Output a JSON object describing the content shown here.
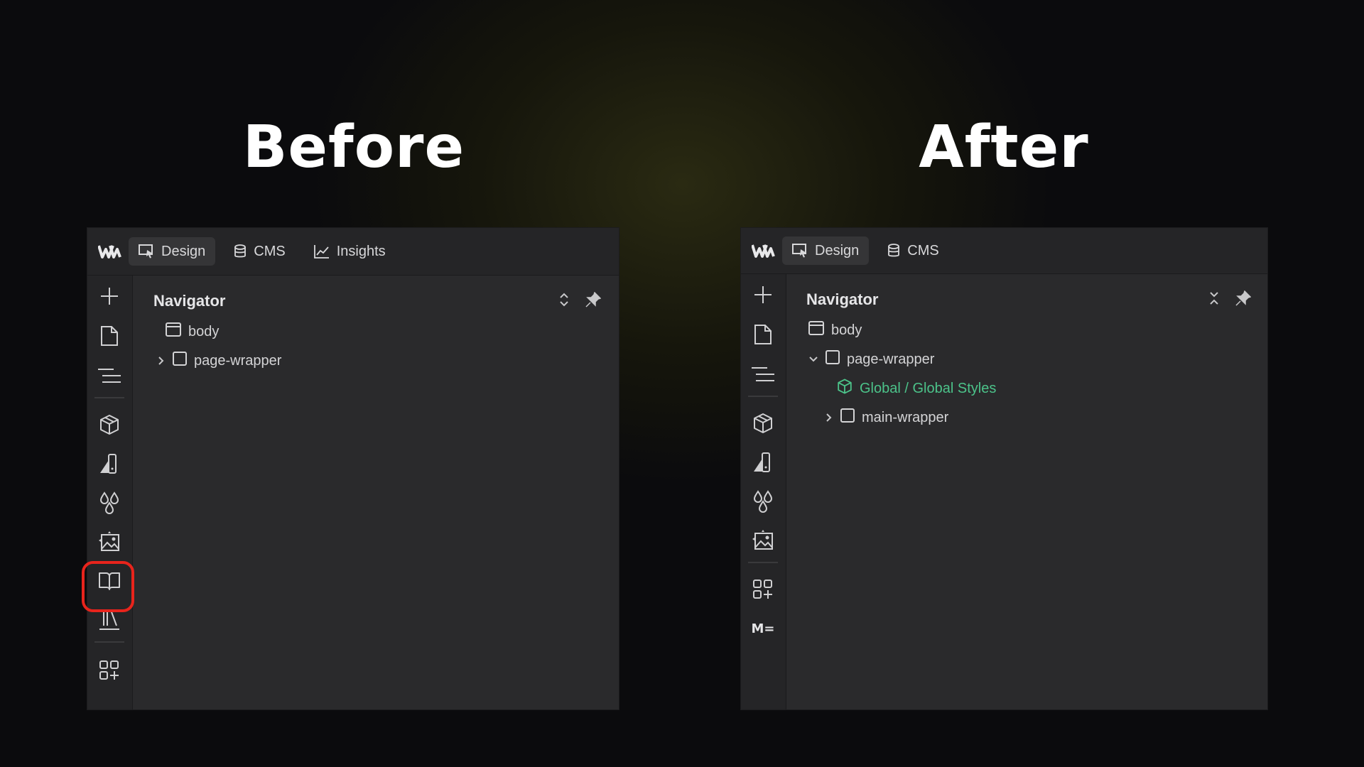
{
  "headings": {
    "before": "Before",
    "after": "After"
  },
  "before": {
    "tabs": [
      {
        "label": "Design",
        "icon": "cursor-select-icon",
        "active": true
      },
      {
        "label": "CMS",
        "icon": "database-icon",
        "active": false
      },
      {
        "label": "Insights",
        "icon": "line-chart-icon",
        "active": false
      }
    ],
    "navigator": {
      "title": "Navigator",
      "tree": [
        "body",
        "page-wrapper"
      ]
    },
    "highlight_color": "#e8241c"
  },
  "after": {
    "tabs": [
      {
        "label": "Design",
        "icon": "cursor-select-icon",
        "active": true
      },
      {
        "label": "CMS",
        "icon": "database-icon",
        "active": false
      }
    ],
    "navigator": {
      "title": "Navigator",
      "tree": [
        "body",
        "page-wrapper",
        "Global / Global Styles",
        "main-wrapper"
      ]
    },
    "rail_badge": "M=",
    "component_color": "#4cc38a"
  }
}
